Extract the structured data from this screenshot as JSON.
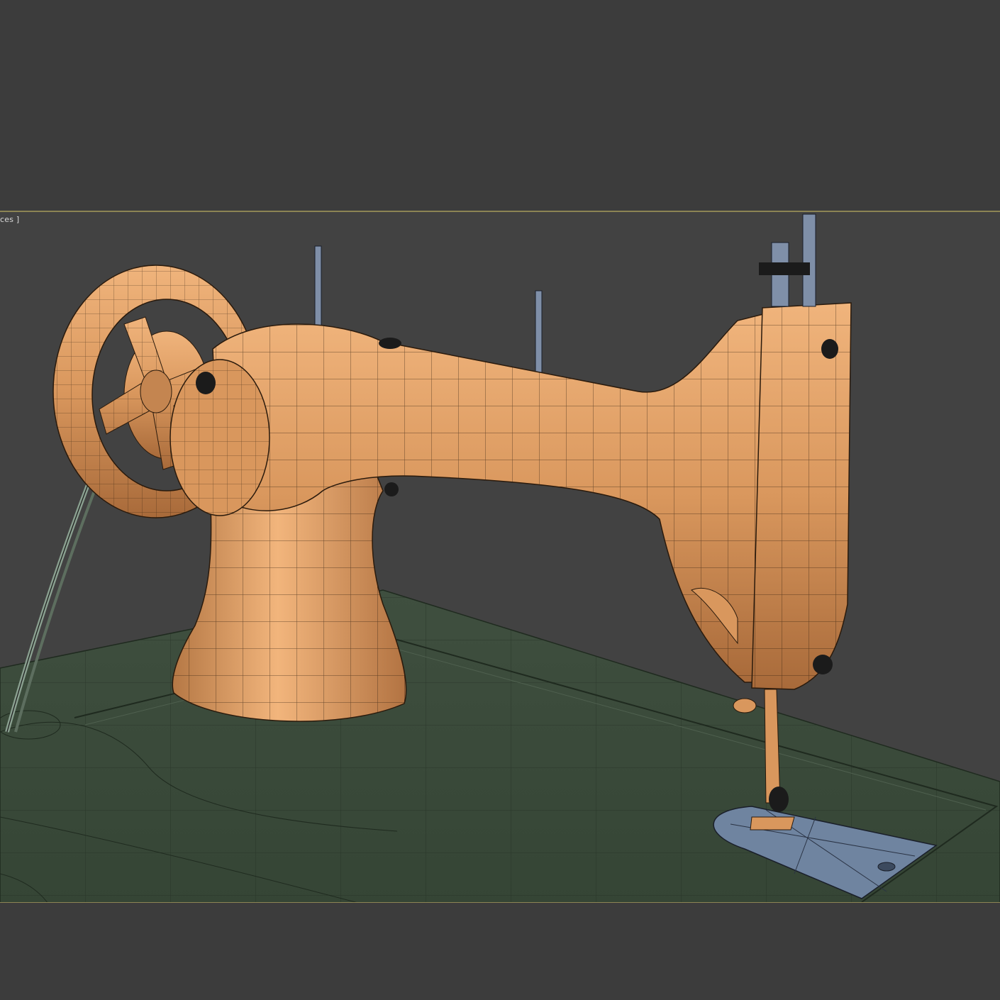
{
  "viewport": {
    "label": "ces ]"
  },
  "colors": {
    "background": "#3c3c3c",
    "viewport_background": "#424242",
    "viewport_border": "#8c8454",
    "machine_body": "#d9975d",
    "table_top": "#3a4a3a",
    "needle_plate": "#6f84a0",
    "spool_pins": "#7f8fa8",
    "wire": "#1a1a1a"
  },
  "scene": {
    "object": "sewing-machine-wireframe-model",
    "parts": [
      "handwheel",
      "belt",
      "arm",
      "pillar",
      "head",
      "spool-pin-left",
      "spool-pin-right",
      "needle-bar",
      "presser-foot",
      "needle-plate",
      "cabinet-table"
    ]
  }
}
